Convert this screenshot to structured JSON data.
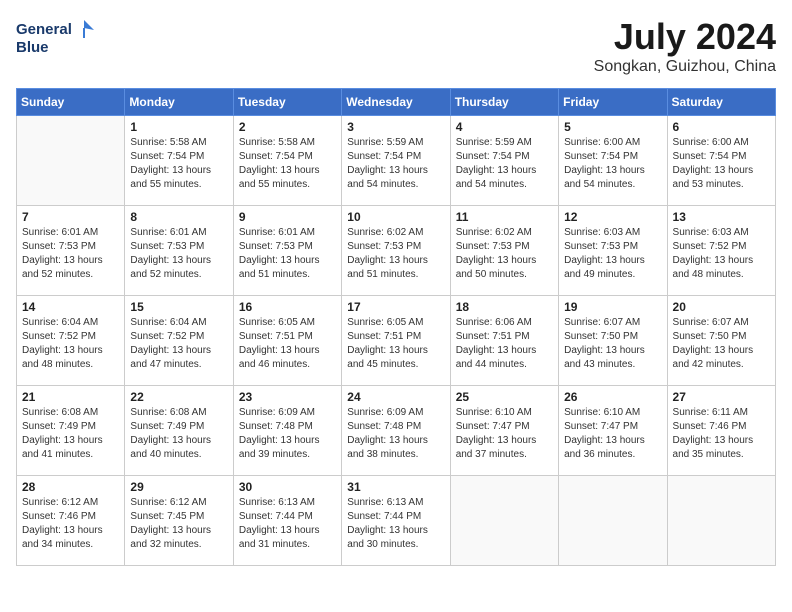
{
  "logo": {
    "line1": "General",
    "line2": "Blue"
  },
  "title": "July 2024",
  "location": "Songkan, Guizhou, China",
  "days_header": [
    "Sunday",
    "Monday",
    "Tuesday",
    "Wednesday",
    "Thursday",
    "Friday",
    "Saturday"
  ],
  "weeks": [
    [
      {
        "day": "",
        "info": ""
      },
      {
        "day": "1",
        "info": "Sunrise: 5:58 AM\nSunset: 7:54 PM\nDaylight: 13 hours\nand 55 minutes."
      },
      {
        "day": "2",
        "info": "Sunrise: 5:58 AM\nSunset: 7:54 PM\nDaylight: 13 hours\nand 55 minutes."
      },
      {
        "day": "3",
        "info": "Sunrise: 5:59 AM\nSunset: 7:54 PM\nDaylight: 13 hours\nand 54 minutes."
      },
      {
        "day": "4",
        "info": "Sunrise: 5:59 AM\nSunset: 7:54 PM\nDaylight: 13 hours\nand 54 minutes."
      },
      {
        "day": "5",
        "info": "Sunrise: 6:00 AM\nSunset: 7:54 PM\nDaylight: 13 hours\nand 54 minutes."
      },
      {
        "day": "6",
        "info": "Sunrise: 6:00 AM\nSunset: 7:54 PM\nDaylight: 13 hours\nand 53 minutes."
      }
    ],
    [
      {
        "day": "7",
        "info": "Sunrise: 6:01 AM\nSunset: 7:53 PM\nDaylight: 13 hours\nand 52 minutes."
      },
      {
        "day": "8",
        "info": "Sunrise: 6:01 AM\nSunset: 7:53 PM\nDaylight: 13 hours\nand 52 minutes."
      },
      {
        "day": "9",
        "info": "Sunrise: 6:01 AM\nSunset: 7:53 PM\nDaylight: 13 hours\nand 51 minutes."
      },
      {
        "day": "10",
        "info": "Sunrise: 6:02 AM\nSunset: 7:53 PM\nDaylight: 13 hours\nand 51 minutes."
      },
      {
        "day": "11",
        "info": "Sunrise: 6:02 AM\nSunset: 7:53 PM\nDaylight: 13 hours\nand 50 minutes."
      },
      {
        "day": "12",
        "info": "Sunrise: 6:03 AM\nSunset: 7:53 PM\nDaylight: 13 hours\nand 49 minutes."
      },
      {
        "day": "13",
        "info": "Sunrise: 6:03 AM\nSunset: 7:52 PM\nDaylight: 13 hours\nand 48 minutes."
      }
    ],
    [
      {
        "day": "14",
        "info": "Sunrise: 6:04 AM\nSunset: 7:52 PM\nDaylight: 13 hours\nand 48 minutes."
      },
      {
        "day": "15",
        "info": "Sunrise: 6:04 AM\nSunset: 7:52 PM\nDaylight: 13 hours\nand 47 minutes."
      },
      {
        "day": "16",
        "info": "Sunrise: 6:05 AM\nSunset: 7:51 PM\nDaylight: 13 hours\nand 46 minutes."
      },
      {
        "day": "17",
        "info": "Sunrise: 6:05 AM\nSunset: 7:51 PM\nDaylight: 13 hours\nand 45 minutes."
      },
      {
        "day": "18",
        "info": "Sunrise: 6:06 AM\nSunset: 7:51 PM\nDaylight: 13 hours\nand 44 minutes."
      },
      {
        "day": "19",
        "info": "Sunrise: 6:07 AM\nSunset: 7:50 PM\nDaylight: 13 hours\nand 43 minutes."
      },
      {
        "day": "20",
        "info": "Sunrise: 6:07 AM\nSunset: 7:50 PM\nDaylight: 13 hours\nand 42 minutes."
      }
    ],
    [
      {
        "day": "21",
        "info": "Sunrise: 6:08 AM\nSunset: 7:49 PM\nDaylight: 13 hours\nand 41 minutes."
      },
      {
        "day": "22",
        "info": "Sunrise: 6:08 AM\nSunset: 7:49 PM\nDaylight: 13 hours\nand 40 minutes."
      },
      {
        "day": "23",
        "info": "Sunrise: 6:09 AM\nSunset: 7:48 PM\nDaylight: 13 hours\nand 39 minutes."
      },
      {
        "day": "24",
        "info": "Sunrise: 6:09 AM\nSunset: 7:48 PM\nDaylight: 13 hours\nand 38 minutes."
      },
      {
        "day": "25",
        "info": "Sunrise: 6:10 AM\nSunset: 7:47 PM\nDaylight: 13 hours\nand 37 minutes."
      },
      {
        "day": "26",
        "info": "Sunrise: 6:10 AM\nSunset: 7:47 PM\nDaylight: 13 hours\nand 36 minutes."
      },
      {
        "day": "27",
        "info": "Sunrise: 6:11 AM\nSunset: 7:46 PM\nDaylight: 13 hours\nand 35 minutes."
      }
    ],
    [
      {
        "day": "28",
        "info": "Sunrise: 6:12 AM\nSunset: 7:46 PM\nDaylight: 13 hours\nand 34 minutes."
      },
      {
        "day": "29",
        "info": "Sunrise: 6:12 AM\nSunset: 7:45 PM\nDaylight: 13 hours\nand 32 minutes."
      },
      {
        "day": "30",
        "info": "Sunrise: 6:13 AM\nSunset: 7:44 PM\nDaylight: 13 hours\nand 31 minutes."
      },
      {
        "day": "31",
        "info": "Sunrise: 6:13 AM\nSunset: 7:44 PM\nDaylight: 13 hours\nand 30 minutes."
      },
      {
        "day": "",
        "info": ""
      },
      {
        "day": "",
        "info": ""
      },
      {
        "day": "",
        "info": ""
      }
    ]
  ]
}
